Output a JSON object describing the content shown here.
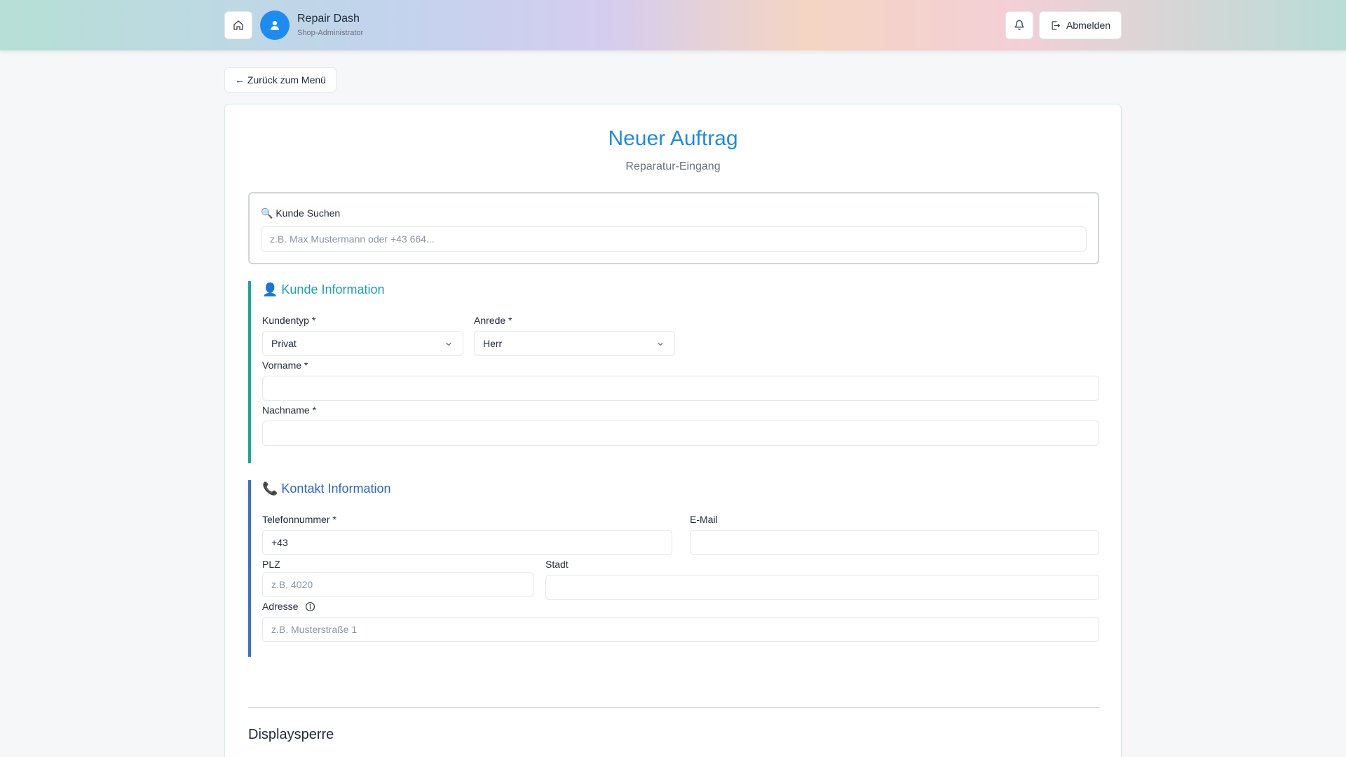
{
  "header": {
    "brand_title": "Repair Dash",
    "brand_subtitle": "Shop-Administrator",
    "logout_label": "Abmelden"
  },
  "nav": {
    "back_label": "← Zurück zum Menü"
  },
  "page": {
    "title": "Neuer Auftrag",
    "subtitle": "Reparatur-Eingang"
  },
  "search": {
    "label": "🔍 Kunde Suchen",
    "placeholder": "z.B. Max Mustermann oder +43 664..."
  },
  "customer": {
    "title": "👤 Kunde Information",
    "kundentyp_label": "Kundentyp *",
    "kundentyp_value": "Privat",
    "anrede_label": "Anrede *",
    "anrede_value": "Herr",
    "vorname_label": "Vorname *",
    "vorname_value": "",
    "nachname_label": "Nachname *",
    "nachname_value": ""
  },
  "contact": {
    "title": "📞 Kontakt Information",
    "telefon_label": "Telefonnummer *",
    "telefon_value": "+43",
    "email_label": "E-Mail",
    "email_value": "",
    "plz_label": "PLZ",
    "plz_placeholder": "z.B. 4020",
    "stadt_label": "Stadt",
    "stadt_value": "",
    "adresse_label": "Adresse",
    "adresse_placeholder": "z.B. Musterstraße 1"
  },
  "display_lock": {
    "title": "Displaysperre"
  },
  "colors": {
    "accent_blue": "#1d8ce0",
    "teal": "#1aa6a0",
    "contact_blue": "#3b6ed6"
  }
}
